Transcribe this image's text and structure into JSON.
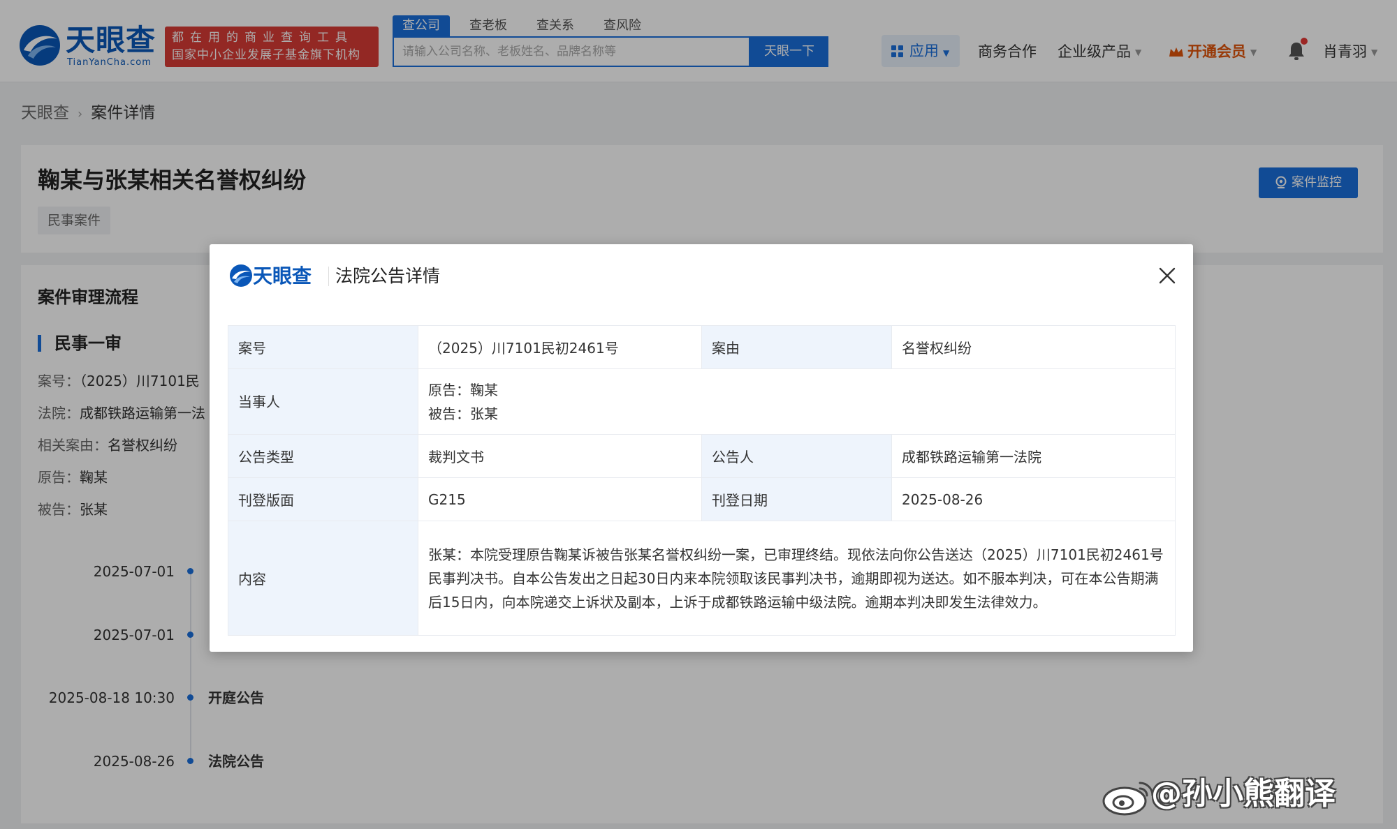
{
  "header": {
    "logo_text": "天眼查",
    "logo_sub": "TianYanCha.com",
    "slogan_line1": "都在用的商业查询工具",
    "slogan_line2": "国家中小企业发展子基金旗下机构",
    "search_tabs": [
      {
        "label": "查公司",
        "active": true
      },
      {
        "label": "查老板",
        "active": false
      },
      {
        "label": "查关系",
        "active": false
      },
      {
        "label": "查风险",
        "active": false
      }
    ],
    "search_placeholder": "请输入公司名称、老板姓名、品牌名称等",
    "search_button": "天眼一下",
    "apps_label": "应用",
    "nav": {
      "business": "商务合作",
      "enterprise": "企业级产品",
      "vip": "开通会员",
      "user": "肖青羽"
    },
    "accent_color": "#1a6fdc",
    "brand_red": "#d93b35"
  },
  "breadcrumb": {
    "home": "天眼查",
    "current": "案件详情"
  },
  "case": {
    "title": "鞠某与张某相关名誉权纠纷",
    "tag": "民事案件",
    "monitor_button": "案件监控"
  },
  "process": {
    "title": "案件审理流程",
    "stage": "民事一审",
    "info": [
      {
        "label": "案号：",
        "value": "（2025）川7101民"
      },
      {
        "label": "法院：",
        "value": "成都铁路运输第一法"
      },
      {
        "label": "相关案由：",
        "value": "名誉权纠纷"
      },
      {
        "label": "原告：",
        "value": "鞠某"
      },
      {
        "label": "被告：",
        "value": "张某"
      }
    ],
    "timeline": [
      {
        "date": "2025-07-01",
        "label": ""
      },
      {
        "date": "2025-07-01",
        "label": ""
      },
      {
        "date": "2025-08-18 10:30",
        "label": "开庭公告"
      },
      {
        "date": "2025-08-26",
        "label": "法院公告"
      }
    ]
  },
  "modal": {
    "logo_text": "天眼查",
    "title": "法院公告详情",
    "rows": {
      "case_no_label": "案号",
      "case_no": "（2025）川7101民初2461号",
      "cause_label": "案由",
      "cause": "名誉权纠纷",
      "party_label": "当事人",
      "plaintiff": "原告：鞠某",
      "defendant": "被告：张某",
      "type_label": "公告类型",
      "type": "裁判文书",
      "announcer_label": "公告人",
      "announcer": "成都铁路运输第一法院",
      "page_label": "刊登版面",
      "page": "G215",
      "date_label": "刊登日期",
      "date": "2025-08-26",
      "content_label": "内容",
      "content": "张某：本院受理原告鞠某诉被告张某名誉权纠纷一案，已审理终结。现依法向你公告送达（2025）川7101民初2461号民事判决书。自本公告发出之日起30日内来本院领取该民事判决书，逾期即视为送达。如不服本判决，可在本公告期满后15日内，向本院递交上诉状及副本，上诉于成都铁路运输中级法院。逾期本判决即发生法律效力。"
    }
  },
  "watermark": {
    "text": "@孙小熊翻译"
  }
}
